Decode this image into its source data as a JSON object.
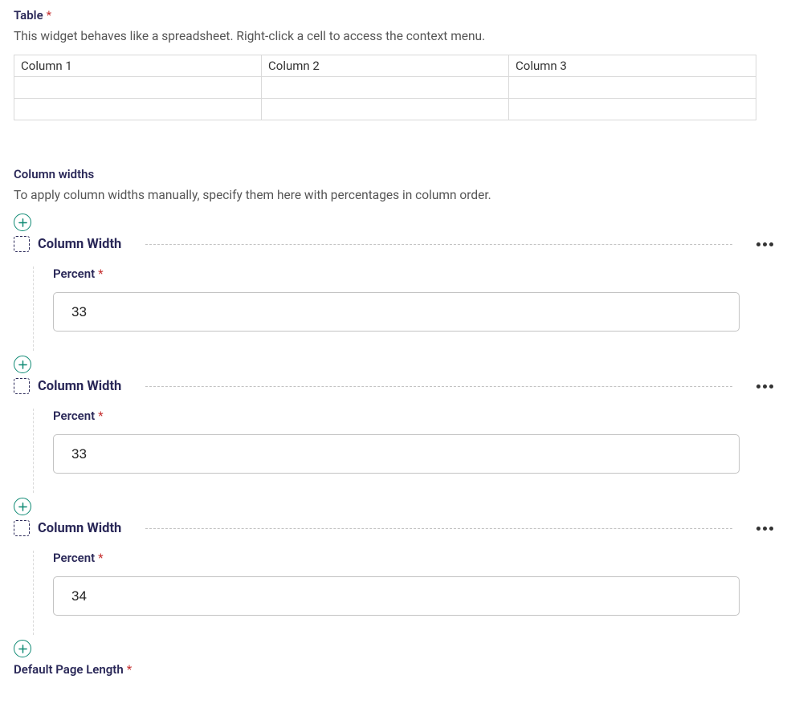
{
  "tableSection": {
    "label": "Table",
    "help": "This widget behaves like a spreadsheet. Right-click a cell to access the context menu.",
    "columns": [
      "Column 1",
      "Column 2",
      "Column 3"
    ]
  },
  "widthsSection": {
    "label": "Column widths",
    "help": "To apply column widths manually, specify them here with percentages in column order.",
    "blockTitle": "Column Width",
    "percentLabel": "Percent",
    "values": [
      "33",
      "33",
      "34"
    ]
  },
  "bottom": {
    "label": "Default Page Length"
  }
}
